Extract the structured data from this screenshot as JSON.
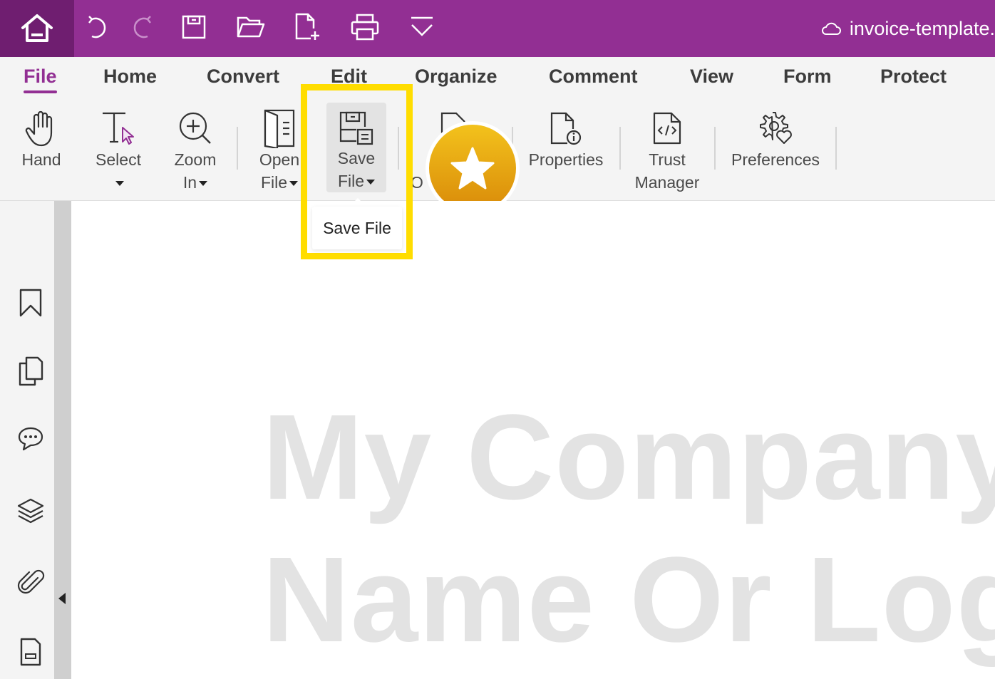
{
  "title_bar": {
    "document_title": "invoice-template.",
    "icons": [
      "home-icon",
      "undo-icon",
      "redo-icon",
      "save-icon",
      "open-folder-icon",
      "new-document-icon",
      "print-icon",
      "customize-icon",
      "cloud-icon"
    ]
  },
  "menu": {
    "tabs": [
      {
        "label": "File",
        "active": true
      },
      {
        "label": "Home"
      },
      {
        "label": "Convert"
      },
      {
        "label": "Edit"
      },
      {
        "label": "Organize"
      },
      {
        "label": "Comment"
      },
      {
        "label": "View"
      },
      {
        "label": "Form"
      },
      {
        "label": "Protect"
      }
    ]
  },
  "ribbon": {
    "hand": {
      "line1": "Hand"
    },
    "select": {
      "line1": "Select"
    },
    "zoom_in": {
      "line1": "Zoom",
      "line2": "In"
    },
    "open_file": {
      "line1": "Open",
      "line2": "File"
    },
    "save_file": {
      "line1": "Save",
      "line2": "File"
    },
    "partial": {
      "line1": "O"
    },
    "properties": {
      "line1": "Properties"
    },
    "trust_manager": {
      "line1": "Trust",
      "line2": "Manager"
    },
    "preferences": {
      "line1": "Preferences"
    }
  },
  "tooltip": {
    "text": "Save File"
  },
  "highlight_color": "#ffdd00",
  "brand_color": "#922f93",
  "sidebar": {
    "icons": [
      "bookmark-icon",
      "pages-icon",
      "comments-icon",
      "layers-icon",
      "attachment-icon",
      "page-icon"
    ]
  },
  "document": {
    "line1": "My Company",
    "line2": "Name Or Logo"
  }
}
